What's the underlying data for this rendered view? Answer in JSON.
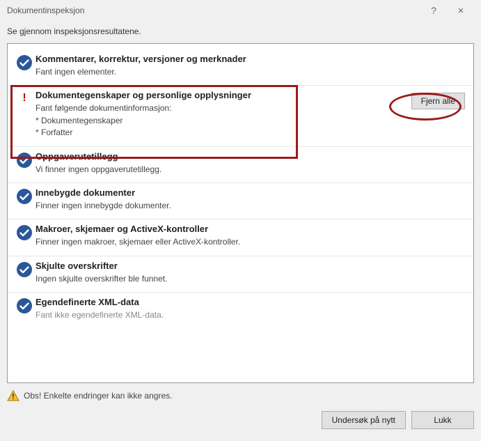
{
  "window": {
    "title": "Dokumentinspeksjon",
    "help_symbol": "?",
    "close_symbol": "×"
  },
  "subheader": "Se gjennom inspeksjonsresultatene.",
  "items": [
    {
      "status": "ok",
      "title": "Kommentarer, korrektur, versjoner og merknader",
      "desc": "Fant ingen elementer.",
      "action": null
    },
    {
      "status": "found",
      "title": "Dokumentegenskaper og personlige opplysninger",
      "desc": "Fant følgende dokumentinformasjon:\n* Dokumentegenskaper\n* Forfatter",
      "action": "Fjern alle"
    },
    {
      "status": "ok",
      "title": "Oppgaverutetillegg",
      "desc": "Vi finner ingen oppgaverutetillegg.",
      "action": null
    },
    {
      "status": "ok",
      "title": "Innebygde dokumenter",
      "desc": "Finner ingen innebygde dokumenter.",
      "action": null
    },
    {
      "status": "ok",
      "title": "Makroer, skjemaer og ActiveX-kontroller",
      "desc": "Finner ingen makroer, skjemaer eller ActiveX-kontroller.",
      "action": null
    },
    {
      "status": "ok",
      "title": "Skjulte overskrifter",
      "desc": "Ingen skjulte overskrifter ble funnet.",
      "action": null
    },
    {
      "status": "ok",
      "title": "Egendefinerte XML-data",
      "desc": "Fant ikke egendefinerte XML-data.",
      "action": null
    }
  ],
  "footer": {
    "note": "Obs!  Enkelte endringer kan ikke angres.",
    "reinspect": "Undersøk på nytt",
    "close": "Lukk"
  }
}
